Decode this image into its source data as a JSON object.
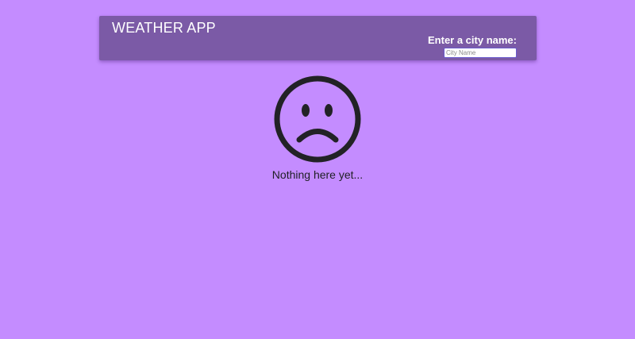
{
  "header": {
    "title": "WEATHER APP",
    "city_label": "Enter a city name:",
    "city_input": {
      "placeholder": "City Name",
      "value": ""
    }
  },
  "empty_state": {
    "icon": "sad-face-icon",
    "message": "Nothing here yet..."
  },
  "colors": {
    "background": "#c48cff",
    "header_background": "#7b5aa6",
    "header_text": "#ffffff",
    "icon": "#222226",
    "message_text": "#1f1f24"
  }
}
